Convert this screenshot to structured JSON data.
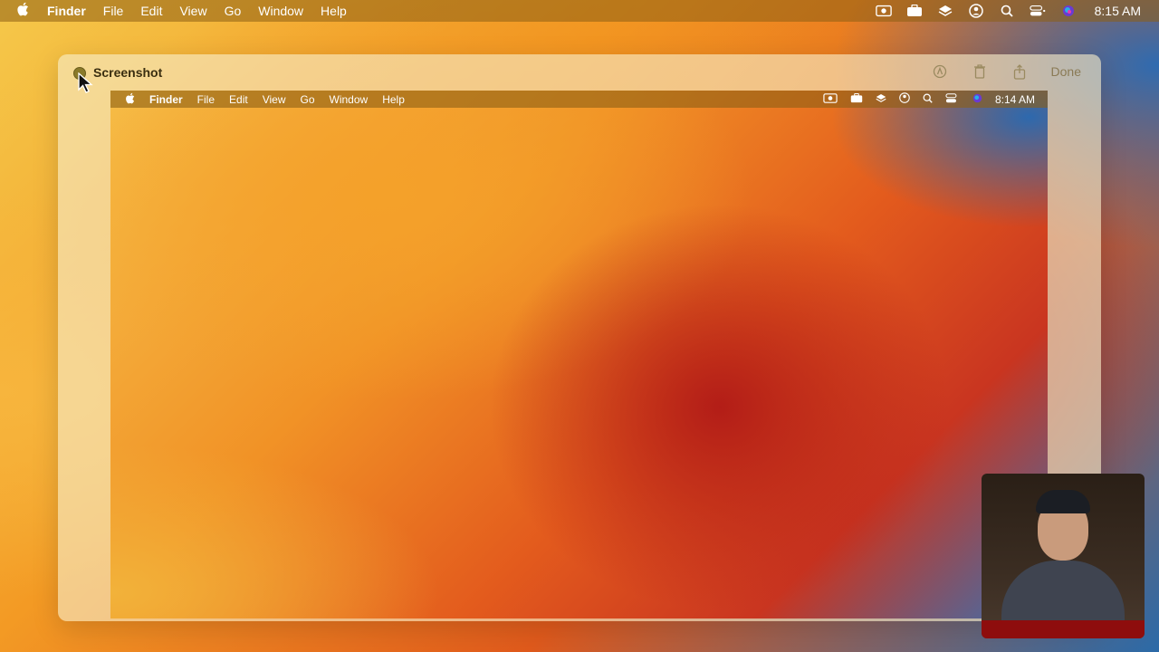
{
  "menubar": {
    "apple_label": "",
    "items": [
      "Finder",
      "File",
      "Edit",
      "View",
      "Go",
      "Window",
      "Help"
    ],
    "status_icons": [
      "screen-record-icon",
      "toolbox-icon",
      "layers-icon",
      "user-icon",
      "search-icon",
      "control-center-icon",
      "siri-icon"
    ],
    "clock": "8:15 AM"
  },
  "window": {
    "title": "Screenshot",
    "toolbar": {
      "markup_icon": "markup-icon",
      "trash_icon": "trash-icon",
      "share_icon": "share-icon",
      "done_label": "Done"
    }
  },
  "screenshot": {
    "menubar": {
      "items": [
        "Finder",
        "File",
        "Edit",
        "View",
        "Go",
        "Window",
        "Help"
      ],
      "clock": "8:14 AM"
    }
  },
  "colors": {
    "accent_orange": "#f19226",
    "deep_red": "#b31d17",
    "sky_blue": "#2d69ae"
  }
}
